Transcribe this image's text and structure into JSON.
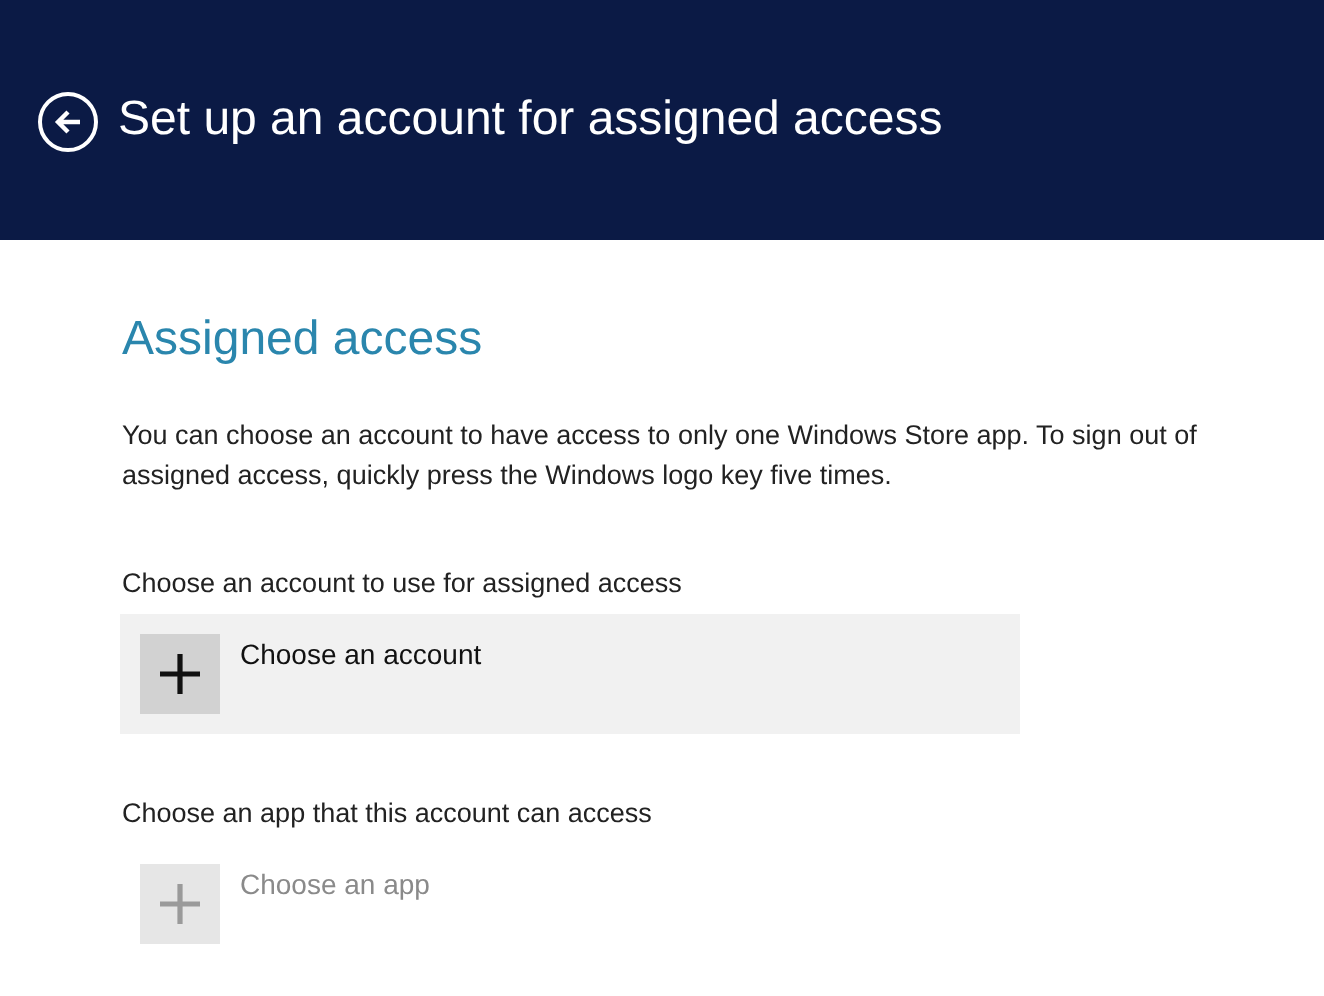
{
  "header": {
    "title": "Set up an account for assigned access"
  },
  "section": {
    "heading": "Assigned access",
    "description": "You can choose an account to have access to only one Windows Store app. To sign out of assigned access, quickly press the Windows logo key five times."
  },
  "pickers": [
    {
      "label": "Choose an account to use for assigned access",
      "button": "Choose an account",
      "disabled": false
    },
    {
      "label": "Choose an app that this account can access",
      "button": "Choose an app",
      "disabled": true
    }
  ]
}
